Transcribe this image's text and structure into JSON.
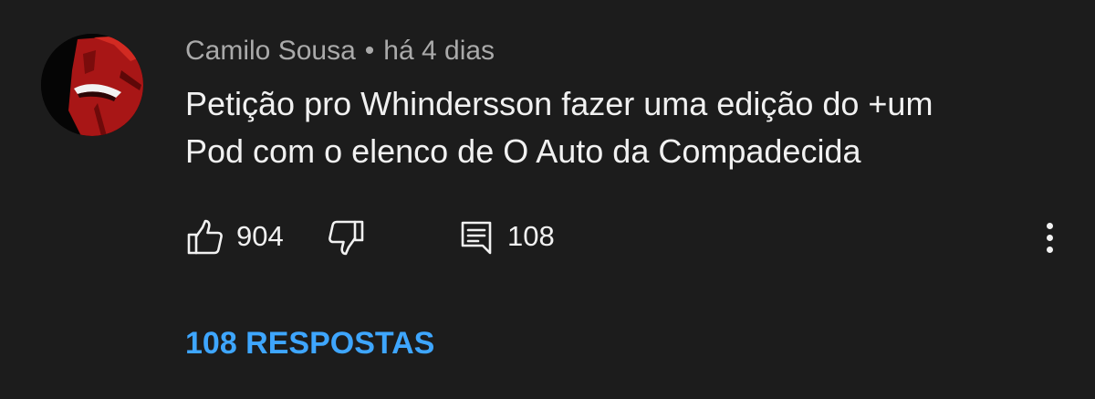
{
  "comment": {
    "author": "Camilo Sousa",
    "separator": "•",
    "timestamp": "há 4 dias",
    "text_lines": [
      "Petição pro Whindersson fazer uma edição do +um",
      "Pod com o elenco de O Auto da Compadecida"
    ],
    "likes": "904",
    "replies_count": "108",
    "replies_link": "108 RESPOSTAS"
  },
  "icons": {
    "like": "thumbs-up-icon",
    "dislike": "thumbs-down-icon",
    "reply": "comment-icon",
    "more": "more-vertical-icon",
    "avatar": "red-masked-character-avatar"
  },
  "colors": {
    "background": "#1c1c1c",
    "primary_text": "#f1f1f1",
    "secondary_text": "#aaaaaa",
    "link": "#3ea6ff",
    "avatar_accent": "#b01818"
  }
}
